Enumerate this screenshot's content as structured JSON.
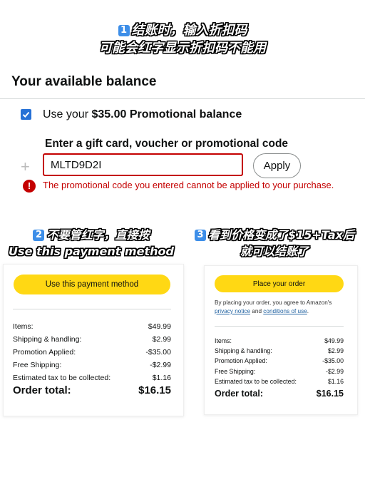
{
  "captions": {
    "step1_num": "1",
    "step1_line1": "结账时，输入折扣码",
    "step1_line2": "可能会红字显示折扣码不能用",
    "step2_num": "2",
    "step2_line1": "不要管红字，直接按",
    "step2_line2": "Use this payment method",
    "step3_num": "3",
    "step3_line1": "看到价格变成了$15+Tax后",
    "step3_line2": "就可以结账了"
  },
  "balance": {
    "title": "Your available balance",
    "use_prefix": "Use your",
    "use_amount": "$35.00 Promotional balance",
    "checked": true
  },
  "gift_card": {
    "label": "Enter a gift card, voucher or promotional code",
    "code_value": "MLTD9D2I",
    "apply_label": "Apply",
    "error_icon": "!",
    "error_text": "The promotional code you entered cannot be applied to your purchase."
  },
  "left_panel": {
    "button_label": "Use this payment method",
    "rows": [
      {
        "label": "Items:",
        "value": "$49.99"
      },
      {
        "label": "Shipping & handling:",
        "value": "$2.99"
      },
      {
        "label": "Promotion Applied:",
        "value": "-$35.00"
      },
      {
        "label": "Free Shipping:",
        "value": "-$2.99"
      },
      {
        "label": "Estimated tax to be collected:",
        "value": "$1.16"
      }
    ],
    "total_label": "Order total:",
    "total_value": "$16.15"
  },
  "right_panel": {
    "button_label": "Place your order",
    "agree_prefix": "By placing your order, you agree to Amazon's",
    "privacy_link": "privacy notice",
    "agree_and": "and",
    "conditions_link": "conditions of use",
    "agree_end": ".",
    "rows": [
      {
        "label": "Items:",
        "value": "$49.99"
      },
      {
        "label": "Shipping & handling:",
        "value": "$2.99"
      },
      {
        "label": "Promotion Applied:",
        "value": "-$35.00"
      },
      {
        "label": "Free Shipping:",
        "value": "-$2.99"
      },
      {
        "label": "Estimated tax to be collected:",
        "value": "$1.16"
      }
    ],
    "total_label": "Order total:",
    "total_value": "$16.15"
  },
  "colors": {
    "accent_yellow": "#ffd814",
    "error_red": "#c40000",
    "checkbox_blue": "#2671d6",
    "link_blue": "#2162a1"
  },
  "icons": [
    "checkbox-checked-icon",
    "plus-icon",
    "error-icon"
  ]
}
